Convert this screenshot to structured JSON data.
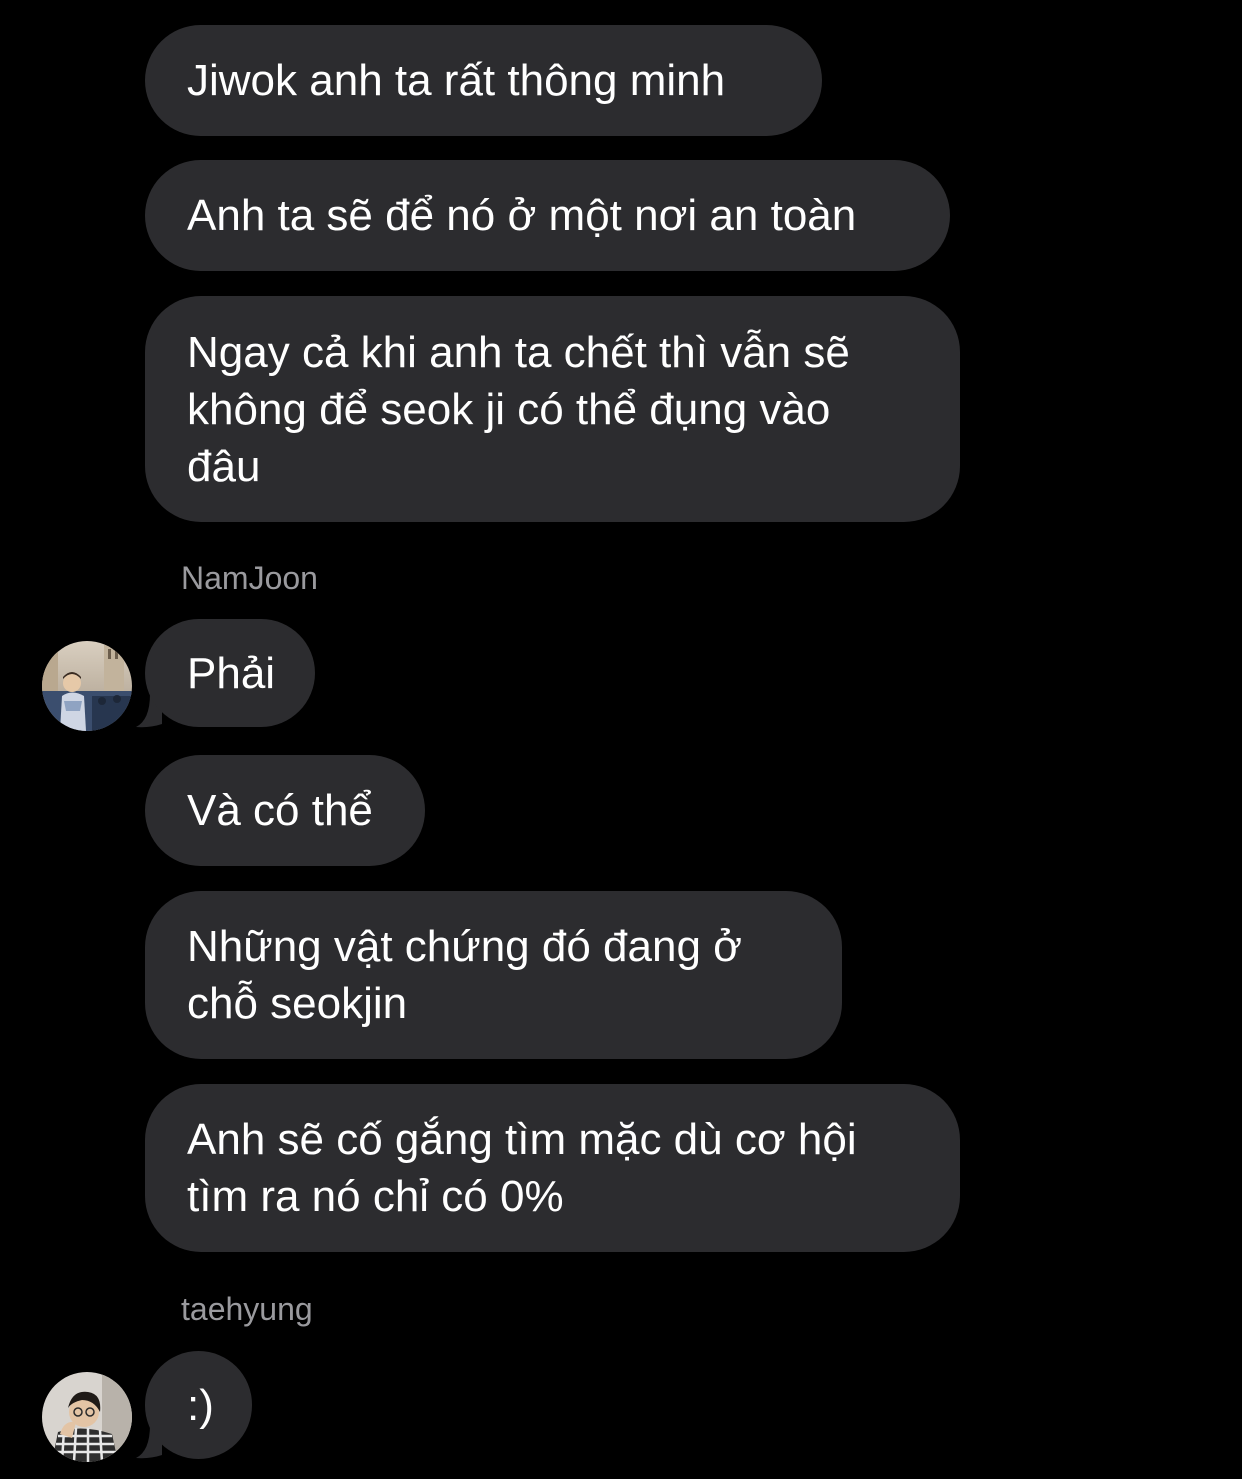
{
  "colors": {
    "background": "#000000",
    "bubble": "#2c2c2f",
    "text": "#ffffff",
    "sender_name": "#9a9a9e"
  },
  "messages": [
    {
      "text": "Jiwok anh ta rất thông minh"
    },
    {
      "text": "Anh ta sẽ để nó ở một nơi an toàn"
    },
    {
      "text": "Ngay cả khi anh ta chết thì vẫn sẽ\nkhông để seok ji có thể đụng vào\nđâu"
    },
    {
      "sender": "NamJoon",
      "text": "Phải"
    },
    {
      "text": "Và có thể"
    },
    {
      "text": "Những vật chứng đó đang ở\nchỗ seokjin"
    },
    {
      "text": "Anh sẽ cố gắng tìm mặc dù cơ hội\ntìm ra nó chỉ có 0%"
    },
    {
      "sender": "taehyung",
      "text": ":)"
    }
  ],
  "icons": {
    "avatar_namjoon": "avatar-photo-icon",
    "avatar_taehyung": "avatar-photo-icon",
    "bubble_tail": "bubble-tail-icon"
  }
}
